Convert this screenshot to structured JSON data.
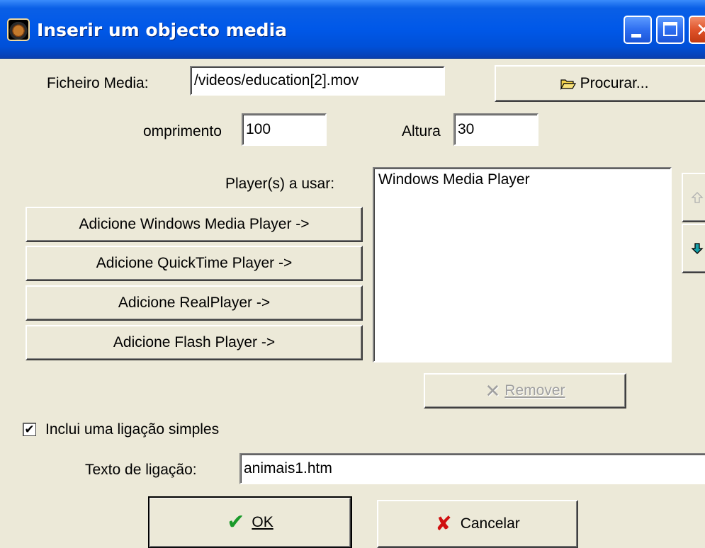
{
  "window": {
    "title": "Inserir um objecto media"
  },
  "media_file": {
    "label": "Ficheiro Media:",
    "value": "/videos/education[2].mov",
    "browse_label": "Procurar..."
  },
  "size": {
    "width_label": "omprimento",
    "width_value": "100",
    "height_label": "Altura",
    "height_value": "30"
  },
  "players": {
    "label": "Player(s) a usar:",
    "add_buttons": [
      "Adicione Windows Media Player ->",
      "Adicione QuickTime Player ->",
      "Adicione RealPlayer ->",
      "Adicione Flash Player ->"
    ],
    "selected": [
      "Windows Media Player"
    ],
    "remove_label": "Remover"
  },
  "link": {
    "checkbox_label": "Inclui uma ligação simples",
    "checked": true,
    "text_label": "Texto de ligação:",
    "text_value": "animais1.htm"
  },
  "footer": {
    "ok_label": "OK",
    "cancel_label": "Cancelar"
  },
  "colors": {
    "titlebar": "#0058e8",
    "dialog_bg": "#ECE9D8",
    "ok_check": "#1a9a2a",
    "cancel_x": "#d01010",
    "down_arrow": "#18a0a8"
  }
}
